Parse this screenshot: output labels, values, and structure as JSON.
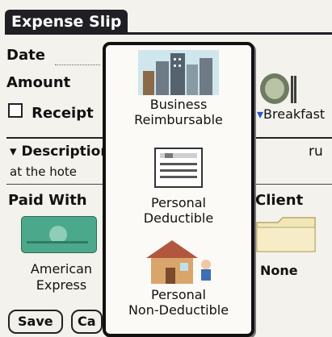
{
  "app": {
    "title": "Expense Slip"
  },
  "form": {
    "date_label": "Date",
    "amount_label": "Amount",
    "receipt_label": "Receipt",
    "description_label": "Description",
    "description_value_fragment": "at the hote",
    "description_right_fragment": "ru",
    "paid_with_label": "Paid With",
    "paid_with_value_line1": "American",
    "paid_with_value_line2": "Express",
    "client_label": "Client",
    "client_value": "None",
    "category_label": "Breakfast"
  },
  "buttons": {
    "save": "Save",
    "cancel_fragment": "Ca"
  },
  "popup": {
    "items": [
      {
        "line1": "Business",
        "line2": "Reimbursable",
        "icon": "city-skyline-icon"
      },
      {
        "line1": "Personal",
        "line2": "Deductible",
        "icon": "form-document-icon"
      },
      {
        "line1": "Personal",
        "line2": "Non-Deductible",
        "icon": "house-icon"
      }
    ]
  },
  "colors": {
    "titlebar_bg": "#1f1f24",
    "popup_border": "#111111",
    "dropdown_arrow": "#2455c8",
    "card_green": "#4ca88a",
    "folder_yellow": "#f1e7b8"
  }
}
